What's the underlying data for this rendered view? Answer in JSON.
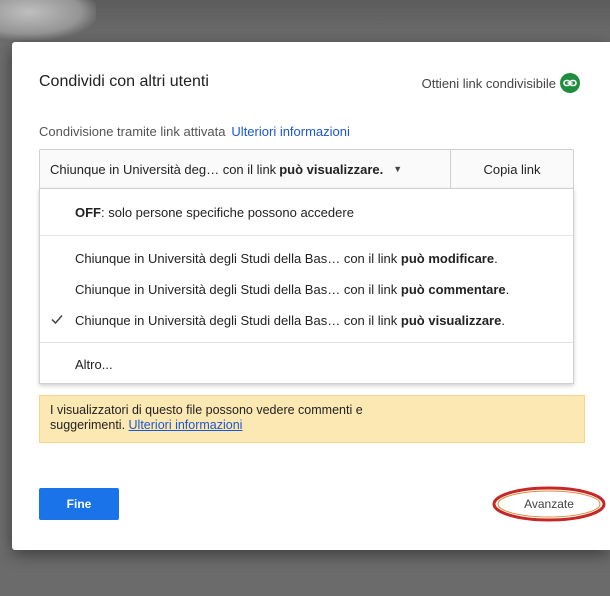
{
  "dialog": {
    "title": "Condividi con altri utenti",
    "get_link_label": "Ottieni link condivisibile",
    "status_text": "Condivisione tramite link attivata",
    "status_more": "Ulteriori informazioni"
  },
  "share_bar": {
    "prefix": "Chiunque in Università deg… con il link",
    "permission": "può visualizzare.",
    "copy_label": "Copia link"
  },
  "menu": {
    "off_strong": "OFF",
    "off_text": ": solo persone specifiche possono accedere",
    "options": [
      {
        "prefix": "Chiunque in Università degli Studi della Bas…  con il link",
        "permission": "può modificare",
        "suffix": ".",
        "checked": false
      },
      {
        "prefix": "Chiunque in Università degli Studi della Bas…  con il link",
        "permission": "può commentare",
        "suffix": ".",
        "checked": false
      },
      {
        "prefix": "Chiunque in Università degli Studi della Bas…  con il link",
        "permission": "può visualizzare",
        "suffix": ".",
        "checked": true
      }
    ],
    "other_label": "Altro..."
  },
  "notice": {
    "line1": "I visualizzatori di questo file possono vedere commenti e",
    "line2": "suggerimenti.",
    "more": "Ulteriori informazioni"
  },
  "footer": {
    "done_label": "Fine",
    "advanced_label": "Avanzate"
  },
  "colors": {
    "primary_button": "#1a73e8",
    "link_blue": "#1a57d6",
    "link_icon_green": "#1e8e3e",
    "notice_bg": "#fce8b2",
    "annotation_red": "#c62828"
  },
  "icons": {
    "get_link": "link-icon",
    "selected": "checkmark-icon",
    "dropdown": "caret-down-icon"
  }
}
